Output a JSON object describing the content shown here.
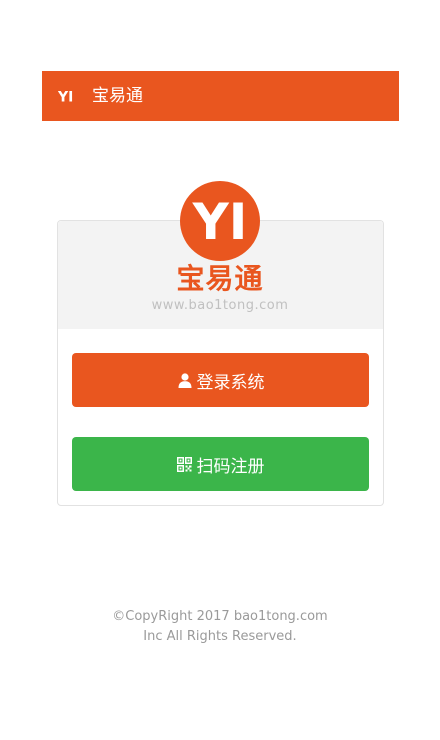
{
  "header": {
    "logo_text": "YI",
    "title": "宝易通"
  },
  "brand": {
    "logo_text": "YI",
    "name": "宝易通",
    "url": "www.bao1tong.com"
  },
  "buttons": {
    "login": {
      "icon": "user-icon",
      "label": "登录系统"
    },
    "register": {
      "icon": "qrcode-icon",
      "label": "扫码注册"
    }
  },
  "footer": {
    "line1": "©CopyRight 2017 bao1tong.com",
    "line2": "Inc All Rights Reserved."
  },
  "colors": {
    "primary": "#E9561F",
    "success": "#3BB54A",
    "footer_text": "#9a9a9a"
  }
}
